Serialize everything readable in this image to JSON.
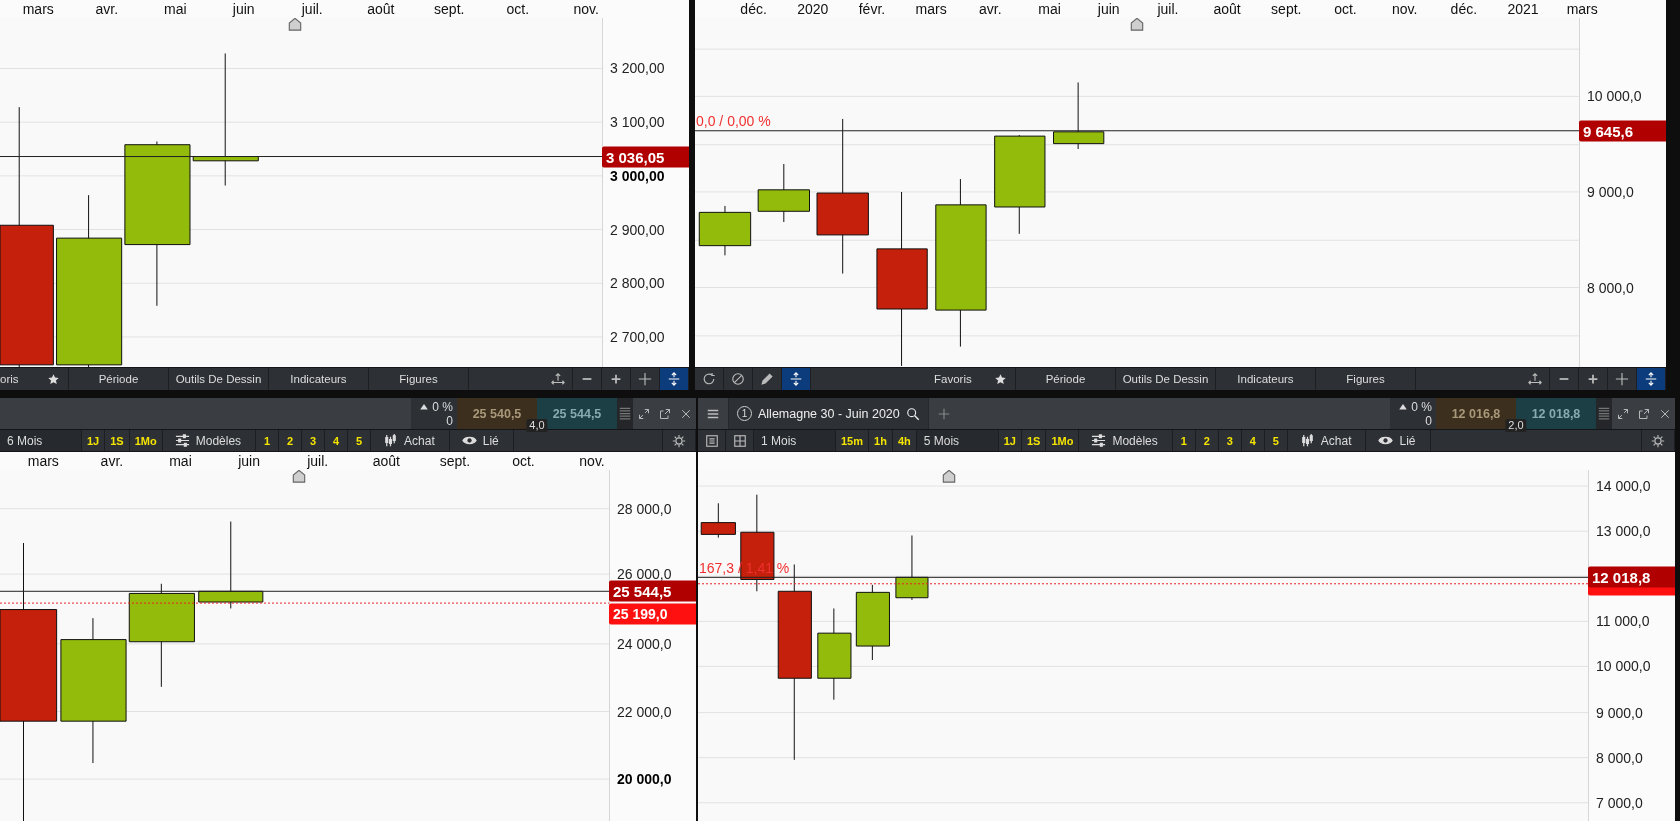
{
  "panels": [
    {
      "months": [
        "mars",
        "avr.",
        "mai",
        "juin",
        "juil.",
        "août",
        "sept.",
        "oct.",
        "nov."
      ],
      "y_axis": [
        {
          "label": "3 200,00",
          "bold": false
        },
        {
          "label": "3 100,00",
          "bold": false
        },
        {
          "label": "3 000,00",
          "bold": true
        },
        {
          "label": "2 900,00",
          "bold": false
        },
        {
          "label": "2 800,00",
          "bold": false
        },
        {
          "label": "2 700,00",
          "bold": false
        }
      ],
      "price_tag": "3 036,05",
      "toolbar": {
        "menus": [
          {
            "kind": "favorites",
            "text": "oris"
          },
          {
            "kind": "menu",
            "text": "Période"
          },
          {
            "kind": "menu",
            "text": "Outils De Dessin"
          },
          {
            "kind": "menu",
            "text": "Indicateurs"
          },
          {
            "kind": "menu",
            "text": "Figures"
          }
        ],
        "view": [
          {
            "kind": "move",
            "on": false
          },
          {
            "kind": "minus",
            "on": false
          },
          {
            "kind": "plus",
            "on": false
          },
          {
            "kind": "crosshair",
            "on": false
          },
          {
            "kind": "updown",
            "on": true
          }
        ]
      }
    },
    {
      "months": [
        "déc.",
        "2020",
        "févr.",
        "mars",
        "avr.",
        "mai",
        "juin",
        "juil.",
        "août",
        "sept.",
        "oct.",
        "nov.",
        "déc.",
        "2021",
        "mars"
      ],
      "y_axis": [
        {
          "label": "10 000,0",
          "bold": false
        },
        {
          "label": "9 000,0",
          "bold": false
        },
        {
          "label": "8 000,0",
          "bold": false
        }
      ],
      "price_tag": "9 645,6",
      "change_label": "0,0 / 0,00 %",
      "toolbar": {
        "tools": [
          {
            "kind": "refresh",
            "on": false
          },
          {
            "kind": "ban",
            "on": false
          },
          {
            "kind": "pencil",
            "on": false
          },
          {
            "kind": "updown",
            "on": true
          }
        ],
        "menus": [
          {
            "kind": "favorites",
            "text": "Favoris"
          },
          {
            "kind": "menu",
            "text": "Période"
          },
          {
            "kind": "menu",
            "text": "Outils De Dessin"
          },
          {
            "kind": "menu",
            "text": "Indicateurs"
          },
          {
            "kind": "menu",
            "text": "Figures"
          }
        ],
        "view": [
          {
            "kind": "move",
            "on": false
          },
          {
            "kind": "minus",
            "on": false
          },
          {
            "kind": "plus",
            "on": false
          },
          {
            "kind": "crosshair",
            "on": false
          },
          {
            "kind": "updown",
            "on": true
          }
        ]
      }
    },
    {
      "header": {
        "change": "0 %",
        "change_points": "0",
        "bid": "25 540,5",
        "ask": "25 544,5",
        "spread": "4,0"
      },
      "sub_toolbar": [
        {
          "kind": "period",
          "text": "6 Mois"
        },
        {
          "kind": "interval",
          "text": "1J"
        },
        {
          "kind": "interval",
          "text": "1S"
        },
        {
          "kind": "interval",
          "text": "1Mo"
        },
        {
          "kind": "models",
          "text": "Modèles"
        },
        {
          "kind": "preset",
          "text": "1"
        },
        {
          "kind": "preset",
          "text": "2"
        },
        {
          "kind": "preset",
          "text": "3"
        },
        {
          "kind": "preset",
          "text": "4"
        },
        {
          "kind": "preset",
          "text": "5"
        },
        {
          "kind": "buy",
          "text": "Achat"
        },
        {
          "kind": "linked",
          "text": "Lié"
        },
        {
          "kind": "gear"
        }
      ],
      "months": [
        "mars",
        "avr.",
        "mai",
        "juin",
        "juil.",
        "août",
        "sept.",
        "oct.",
        "nov."
      ],
      "y_axis": [
        {
          "label": "28 000,0",
          "bold": false
        },
        {
          "label": "26 000,0",
          "bold": false
        },
        {
          "label": "24 000,0",
          "bold": false
        },
        {
          "label": "22 000,0",
          "bold": false
        },
        {
          "label": "20 000,0",
          "bold": true
        }
      ],
      "price_tag": "25 544,5",
      "alert_tag": "25 199,0"
    },
    {
      "header": {
        "tab": {
          "number": "1",
          "title": "Allemagne 30 - Juin 2020"
        },
        "change": "0 %",
        "change_points": "0",
        "bid": "12 016,8",
        "ask": "12 018,8",
        "spread": "2,0"
      },
      "sub_toolbar": [
        {
          "kind": "list"
        },
        {
          "kind": "grid"
        },
        {
          "kind": "period",
          "text": "1 Mois"
        },
        {
          "kind": "interval",
          "text": "15m"
        },
        {
          "kind": "interval",
          "text": "1h"
        },
        {
          "kind": "interval",
          "text": "4h"
        },
        {
          "kind": "period",
          "text": "5 Mois"
        },
        {
          "kind": "interval",
          "text": "1J"
        },
        {
          "kind": "interval",
          "text": "1S"
        },
        {
          "kind": "interval",
          "text": "1Mo"
        },
        {
          "kind": "models",
          "text": "Modèles"
        },
        {
          "kind": "preset",
          "text": "1"
        },
        {
          "kind": "preset",
          "text": "2"
        },
        {
          "kind": "preset",
          "text": "3"
        },
        {
          "kind": "preset",
          "text": "4"
        },
        {
          "kind": "preset",
          "text": "5"
        },
        {
          "kind": "buy",
          "text": "Achat"
        },
        {
          "kind": "linked",
          "text": "Lié"
        },
        {
          "kind": "gear"
        }
      ],
      "y_axis": [
        {
          "label": "14 000,0",
          "bold": false
        },
        {
          "label": "13 000,0",
          "bold": false
        },
        {
          "label": "11 000,0",
          "bold": false
        },
        {
          "label": "10 000,0",
          "bold": false
        },
        {
          "label": "9 000,0",
          "bold": false
        },
        {
          "label": "8 000,0",
          "bold": false
        },
        {
          "label": "7 000,0",
          "bold": false
        }
      ],
      "price_tag": "12 018,8",
      "alert_marker": true,
      "change_label": "167,3 / 1,41 %"
    }
  ]
}
